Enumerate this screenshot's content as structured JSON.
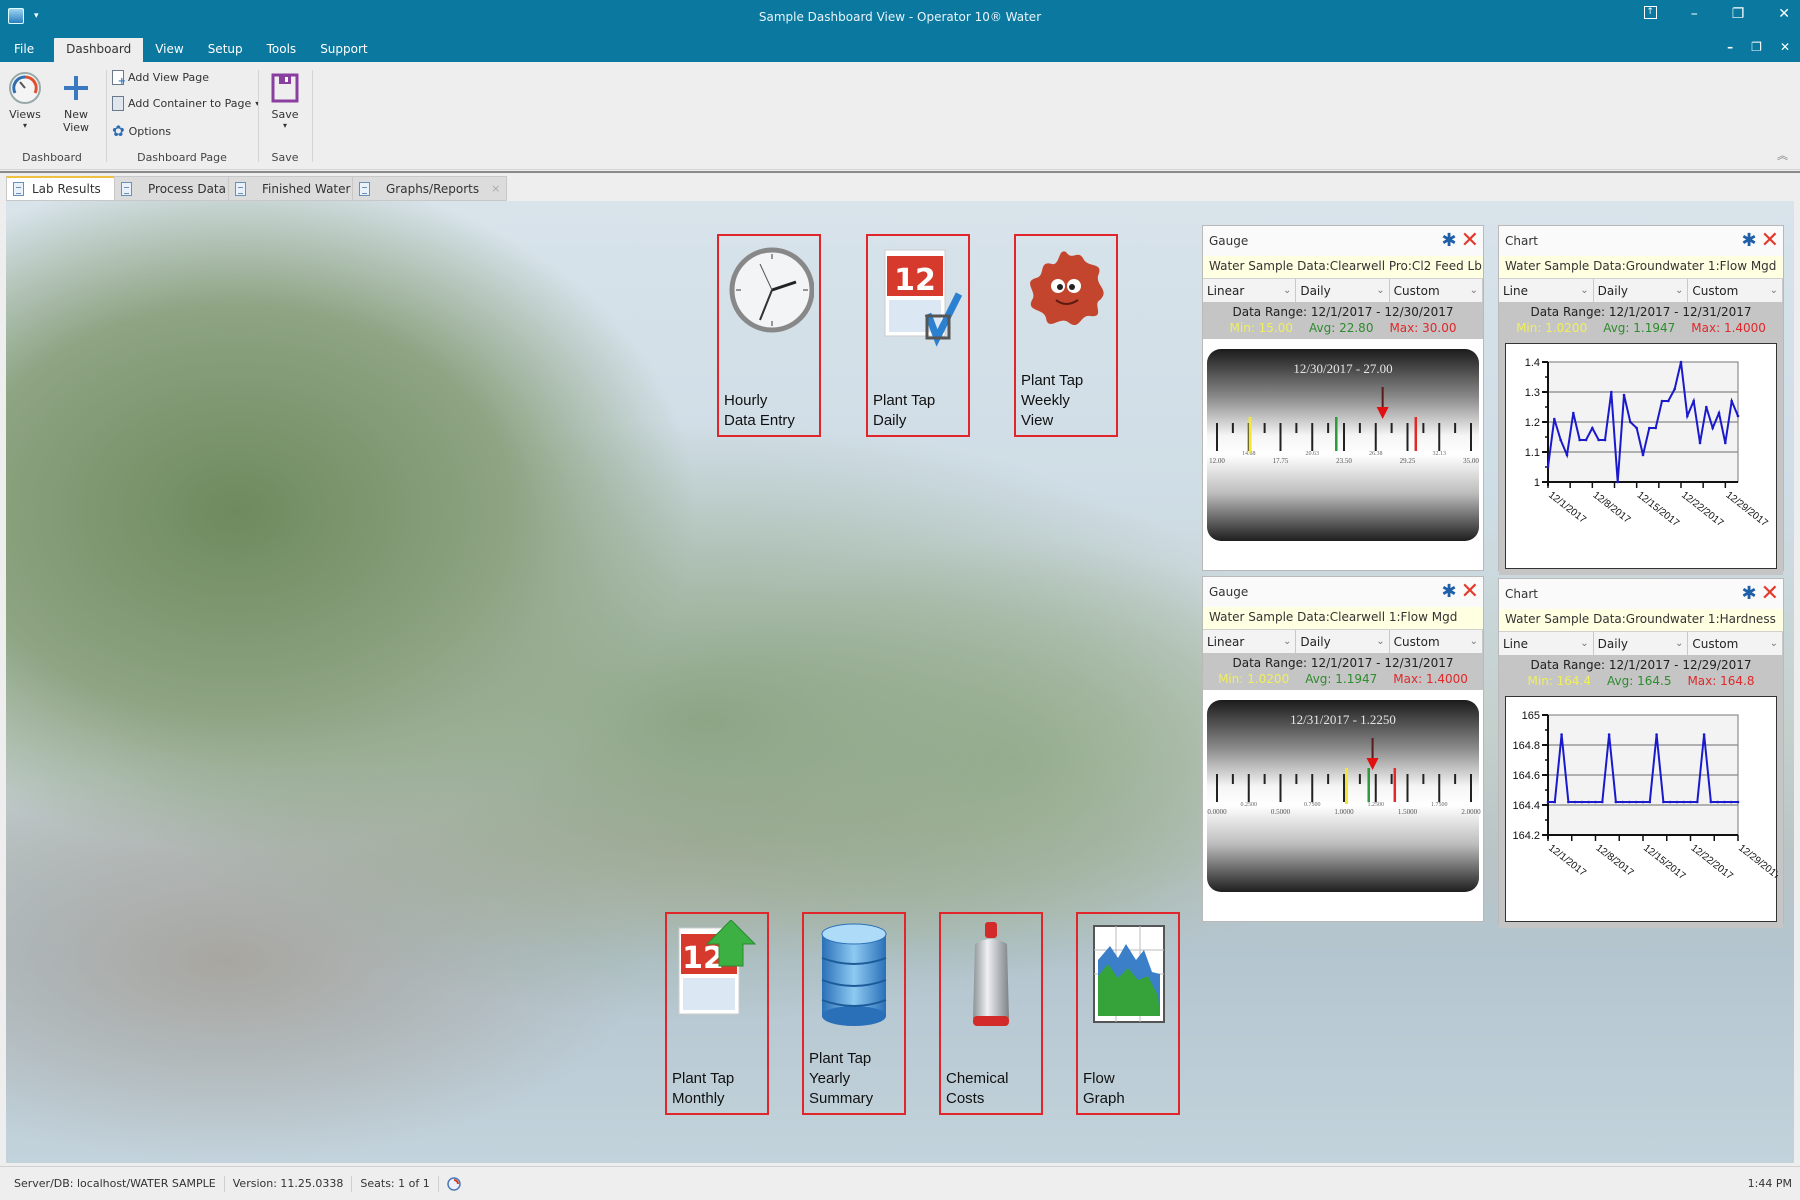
{
  "window": {
    "title": "Sample Dashboard View - Operator 10® Water",
    "controls": [
      "help-icon",
      "minimize-icon",
      "restore-icon",
      "close-icon"
    ],
    "mdi_controls": [
      "minimize-icon",
      "restore-icon",
      "close-icon"
    ]
  },
  "menu": {
    "tabs": [
      {
        "label": "File",
        "active": false
      },
      {
        "label": "Dashboard",
        "active": true
      },
      {
        "label": "View",
        "active": false
      },
      {
        "label": "Setup",
        "active": false
      },
      {
        "label": "Tools",
        "active": false
      },
      {
        "label": "Support",
        "active": false
      }
    ]
  },
  "ribbon": {
    "groups": [
      {
        "label": "Dashboard",
        "buttons": [
          {
            "label": "Views",
            "icon": "gauge-icon",
            "dropdown": true
          },
          {
            "label": "New View",
            "icon": "plus-icon"
          }
        ]
      },
      {
        "label": "Dashboard Page",
        "buttons": [
          {
            "label": "Add View Page",
            "icon": "add-page-icon"
          },
          {
            "label": "Add Container to Page",
            "icon": "add-container-icon",
            "dropdown": true
          },
          {
            "label": "Options",
            "icon": "gear-icon"
          }
        ]
      },
      {
        "label": "Save",
        "buttons": [
          {
            "label": "Save",
            "icon": "save-icon",
            "dropdown": true
          }
        ]
      }
    ]
  },
  "doc_tabs": [
    {
      "label": "Lab Results",
      "active": true
    },
    {
      "label": "Process Data",
      "active": false
    },
    {
      "label": "Finished Water",
      "active": false
    },
    {
      "label": "Graphs/Reports",
      "active": false
    }
  ],
  "tiles": [
    {
      "label_lines": [
        "Hourly",
        "Data Entry"
      ],
      "icon": "clock-icon"
    },
    {
      "label_lines": [
        "Plant Tap",
        "Daily"
      ],
      "icon": "calendar-check-icon",
      "calendar_day": "12"
    },
    {
      "label_lines": [
        "Plant Tap",
        "Weekly",
        "View"
      ],
      "icon": "germ-icon"
    },
    {
      "label_lines": [
        "Plant Tap",
        "Monthly"
      ],
      "icon": "calendar-up-icon",
      "calendar_day": "12"
    },
    {
      "label_lines": [
        "Plant Tap",
        "Yearly",
        "Summary"
      ],
      "icon": "database-icon"
    },
    {
      "label_lines": [
        "Chemical",
        "Costs"
      ],
      "icon": "gas-cylinder-icon"
    },
    {
      "label_lines": [
        "Flow",
        "Graph"
      ],
      "icon": "area-chart-icon"
    }
  ],
  "widgets": {
    "gauge1": {
      "type_label": "Gauge",
      "source": "Water Sample Data:Clearwell Pro:Cl2 Feed Lb",
      "selects": [
        "Linear",
        "Daily",
        "Custom"
      ],
      "range": "Data Range: 12/1/2017 - 12/30/2017",
      "min": "Min: 15.00",
      "avg": "Avg: 22.80",
      "max": "Max: 30.00",
      "reading": "12/30/2017 - 27.00",
      "scale": {
        "min": 12.0,
        "max": 35.0,
        "value": 27.0,
        "min_marker": 15.0,
        "avg_marker": 22.8,
        "max_marker": 30.0,
        "major_labels": [
          "12.00",
          "17.75",
          "23.50",
          "29.25",
          "35.00"
        ],
        "minor_labels": [
          "14.88",
          "20.63",
          "26.38",
          "32.13"
        ]
      }
    },
    "gauge2": {
      "type_label": "Gauge",
      "source": "Water Sample Data:Clearwell 1:Flow Mgd",
      "selects": [
        "Linear",
        "Daily",
        "Custom"
      ],
      "range": "Data Range: 12/1/2017 - 12/31/2017",
      "min": "Min: 1.0200",
      "avg": "Avg: 1.1947",
      "max": "Max: 1.4000",
      "reading": "12/31/2017 - 1.2250",
      "scale": {
        "min": 0.0,
        "max": 2.0,
        "value": 1.225,
        "min_marker": 1.02,
        "avg_marker": 1.1947,
        "max_marker": 1.4,
        "major_labels": [
          "0.0000",
          "0.5000",
          "1.0000",
          "1.5000",
          "2.0000"
        ],
        "minor_labels": [
          "0.2500",
          "0.7500",
          "1.2500",
          "1.7500"
        ]
      }
    },
    "chart1": {
      "type_label": "Chart",
      "source": "Water Sample Data:Groundwater 1:Flow Mgd",
      "selects": [
        "Line",
        "Daily",
        "Custom"
      ],
      "range": "Data Range: 12/1/2017 - 12/31/2017",
      "min": "Min: 1.0200",
      "avg": "Avg: 1.1947",
      "max": "Max: 1.4000"
    },
    "chart2": {
      "type_label": "Chart",
      "source": "Water Sample Data:Groundwater 1:Hardness",
      "selects": [
        "Line",
        "Daily",
        "Custom"
      ],
      "range": "Data Range: 12/1/2017 - 12/29/2017",
      "min": "Min: 164.4",
      "avg": "Avg: 164.5",
      "max": "Max: 164.8"
    }
  },
  "chart_data": [
    {
      "type": "line",
      "title": "Water Sample Data:Groundwater 1:Flow Mgd",
      "xlabel": "",
      "ylabel": "",
      "ylim": [
        1.0,
        1.4
      ],
      "yticks": [
        "1",
        "1.1",
        "1.2",
        "1.3",
        "1.4"
      ],
      "xticks": [
        "12/1/2017",
        "12/8/2017",
        "12/15/2017",
        "12/22/2017",
        "12/29/2017"
      ],
      "grid": true,
      "series": [
        {
          "name": "Flow Mgd",
          "color": "#1a1acc",
          "x": [
            "12/1",
            "12/2",
            "12/3",
            "12/4",
            "12/5",
            "12/6",
            "12/7",
            "12/8",
            "12/9",
            "12/10",
            "12/11",
            "12/12",
            "12/13",
            "12/14",
            "12/15",
            "12/16",
            "12/17",
            "12/18",
            "12/19",
            "12/20",
            "12/21",
            "12/22",
            "12/23",
            "12/24",
            "12/25",
            "12/26",
            "12/27",
            "12/28",
            "12/29",
            "12/30",
            "12/31"
          ],
          "values": [
            1.05,
            1.21,
            1.14,
            1.09,
            1.23,
            1.14,
            1.14,
            1.18,
            1.14,
            1.14,
            1.3,
            1.0,
            1.29,
            1.2,
            1.18,
            1.09,
            1.18,
            1.18,
            1.27,
            1.27,
            1.31,
            1.4,
            1.22,
            1.27,
            1.13,
            1.25,
            1.18,
            1.23,
            1.13,
            1.27,
            1.22
          ]
        }
      ]
    },
    {
      "type": "line",
      "title": "Water Sample Data:Groundwater 1:Hardness",
      "xlabel": "",
      "ylabel": "",
      "ylim": [
        164.2,
        165.0
      ],
      "yticks": [
        "164.2",
        "164.4",
        "164.6",
        "164.8",
        "165"
      ],
      "xticks": [
        "12/1/2017",
        "12/8/2017",
        "12/15/2017",
        "12/22/2017",
        "12/29/2017"
      ],
      "grid": true,
      "series": [
        {
          "name": "Hardness",
          "color": "#1a1acc",
          "x": [
            "12/1",
            "12/2",
            "12/3",
            "12/4",
            "12/5",
            "12/6",
            "12/7",
            "12/8",
            "12/9",
            "12/10",
            "12/11",
            "12/12",
            "12/13",
            "12/14",
            "12/15",
            "12/16",
            "12/17",
            "12/18",
            "12/19",
            "12/20",
            "12/21",
            "12/22",
            "12/23",
            "12/24",
            "12/25",
            "12/26",
            "12/27",
            "12/28",
            "12/29"
          ],
          "values": [
            164.42,
            164.42,
            164.87,
            164.42,
            164.42,
            164.42,
            164.42,
            164.42,
            164.42,
            164.87,
            164.42,
            164.42,
            164.42,
            164.42,
            164.42,
            164.42,
            164.87,
            164.42,
            164.42,
            164.42,
            164.42,
            164.42,
            164.42,
            164.87,
            164.42,
            164.42,
            164.42,
            164.42,
            164.42
          ]
        }
      ]
    }
  ],
  "status": {
    "server": "Server/DB:  localhost/WATER SAMPLE",
    "version": "Version:  11.25.0338",
    "seats": "Seats:  1 of 1",
    "time": "1:44 PM"
  }
}
